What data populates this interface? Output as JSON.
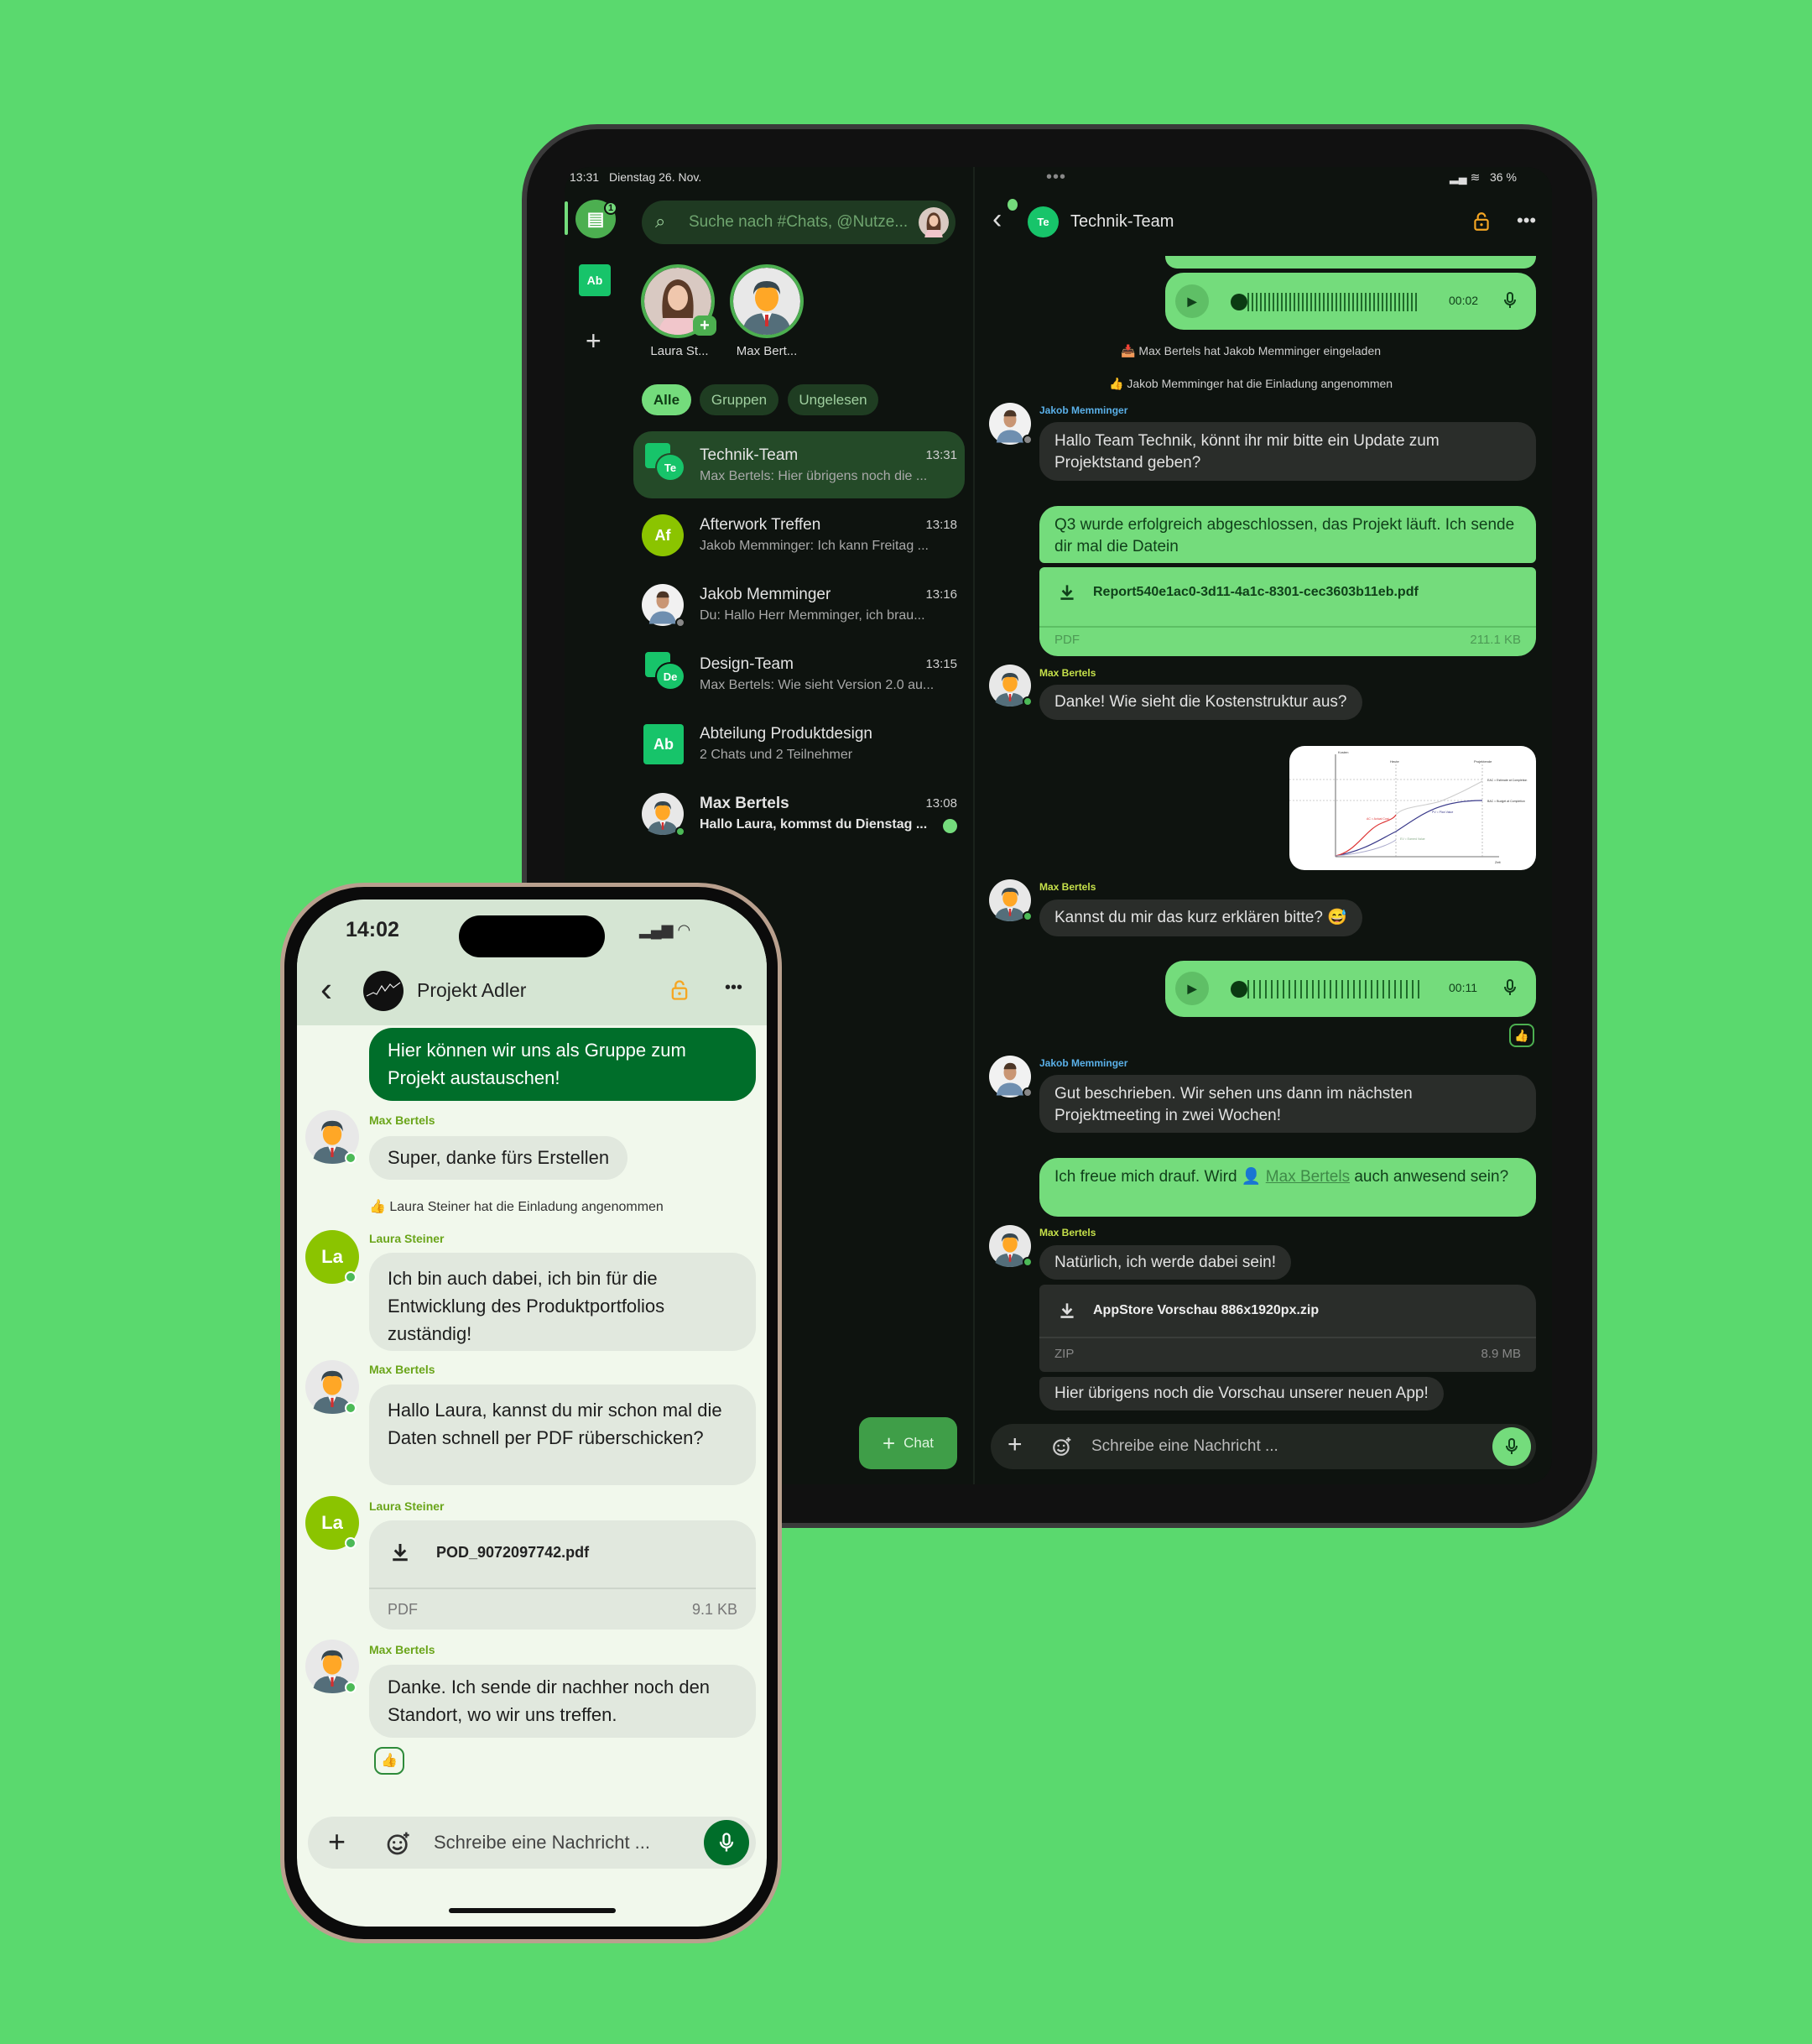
{
  "tablet": {
    "status": {
      "time": "13:31",
      "date": "Dienstag 26. Nov.",
      "battery": "36 %"
    },
    "sidebar": {
      "group_badge": "Ab",
      "unread_badge": "1"
    },
    "search": {
      "placeholder": "Suche nach #Chats, @Nutze..."
    },
    "stories": [
      {
        "label": "Laura St..."
      },
      {
        "label": "Max Bert..."
      }
    ],
    "filters": [
      "Alle",
      "Gruppen",
      "Ungelesen"
    ],
    "chats": [
      {
        "avatar": "Te",
        "title": "Technik-Team",
        "time": "13:31",
        "preview": "Max Bertels: Hier übrigens noch die ..."
      },
      {
        "avatar": "Af",
        "title": "Afterwork Treffen",
        "time": "13:18",
        "preview": "Jakob Memminger: Ich kann Freitag ..."
      },
      {
        "title": "Jakob Memminger",
        "time": "13:16",
        "preview": "Du: Hallo Herr Memminger, ich brau..."
      },
      {
        "avatar": "De",
        "title": "Design-Team",
        "time": "13:15",
        "preview": "Max Bertels: Wie sieht Version 2.0 au..."
      },
      {
        "avatar": "Ab",
        "title": "Abteilung Produktdesign",
        "time": "",
        "preview": "2 Chats und 2 Teilnehmer"
      },
      {
        "title": "Max Bertels",
        "time": "13:08",
        "preview": "Hallo Laura, kommst du Dienstag ..."
      }
    ],
    "new_chat": "Chat",
    "chat": {
      "avatar": "Te",
      "title": "Technik-Team",
      "voice1_duration": "00:02",
      "sys1": "Max Bertels hat Jakob Memminger eingeladen",
      "sys2": "Jakob Memminger hat die Einladung angenommen",
      "m1": {
        "name": "Jakob Memminger",
        "text": "Hallo Team Technik, könnt ihr mir bitte ein Update zum Projektstand geben?"
      },
      "m2": {
        "text": "Q3 wurde erfolgreich abgeschlossen, das Projekt läuft. Ich sende dir mal die Datein",
        "file": "Report540e1ac0-3d11-4a1c-8301-cec3603b11eb.pdf",
        "type": "PDF",
        "size": "211.1 KB"
      },
      "m3": {
        "name": "Max Bertels",
        "text": "Danke! Wie sieht die Kostenstruktur aus?"
      },
      "image_labels": {
        "y": "Kosten",
        "x": "Zeit",
        "today": "Heute",
        "end": "Projektende",
        "eac": "EAC = Estimate at Completion",
        "bac": "BAC = Budget at Completion",
        "ac": "AC = Actual Cost",
        "pv": "PV = Plan Value",
        "ev": "EV = Earned Value"
      },
      "m4": {
        "name": "Max Bertels",
        "text": "Kannst du mir das kurz erklären bitte? 😅"
      },
      "voice2_duration": "00:11",
      "reaction": "👍",
      "m5": {
        "name": "Jakob Memminger",
        "text": "Gut beschrieben. Wir sehen uns dann im nächsten Projektmeeting in zwei Wochen!"
      },
      "m6": {
        "pre": "Ich freue mich drauf. Wird",
        "mention": "Max Bertels",
        "post": "auch anwesend sein?"
      },
      "m7": {
        "name": "Max Bertels",
        "text": "Natürlich, ich werde dabei sein!",
        "file": "AppStore Vorschau 886x1920px.zip",
        "type": "ZIP",
        "size": "8.9 MB",
        "text2": "Hier übrigens noch die Vorschau unserer neuen App!"
      },
      "input_placeholder": "Schreibe eine Nachricht ..."
    }
  },
  "phone": {
    "time": "14:02",
    "title": "Projekt Adler",
    "m1": "Hier können wir uns als Gruppe zum Projekt austauschen!",
    "m2": {
      "name": "Max Bertels",
      "text": "Super, danke fürs Erstellen"
    },
    "sys": "Laura Steiner hat die Einladung angenommen",
    "m3": {
      "avatar": "La",
      "name": "Laura Steiner",
      "text": "Ich bin auch dabei, ich bin für die Entwicklung des Produktportfolios zuständig!"
    },
    "m4": {
      "name": "Max Bertels",
      "text": "Hallo Laura, kannst du mir schon mal die Daten schnell per PDF rüberschicken?"
    },
    "m5": {
      "avatar": "La",
      "name": "Laura Steiner",
      "file": "POD_9072097742.pdf",
      "type": "PDF",
      "size": "9.1 KB"
    },
    "m6": {
      "name": "Max Bertels",
      "text": "Danke. Ich sende dir nachher noch den Standort, wo wir uns treffen."
    },
    "reaction": "👍",
    "input_placeholder": "Schreibe eine Nachricht ..."
  },
  "colors": {
    "background": "#5ad96e",
    "accent": "#74dc7c",
    "phone_accent": "#006e2a",
    "lock": "#f5a623"
  }
}
